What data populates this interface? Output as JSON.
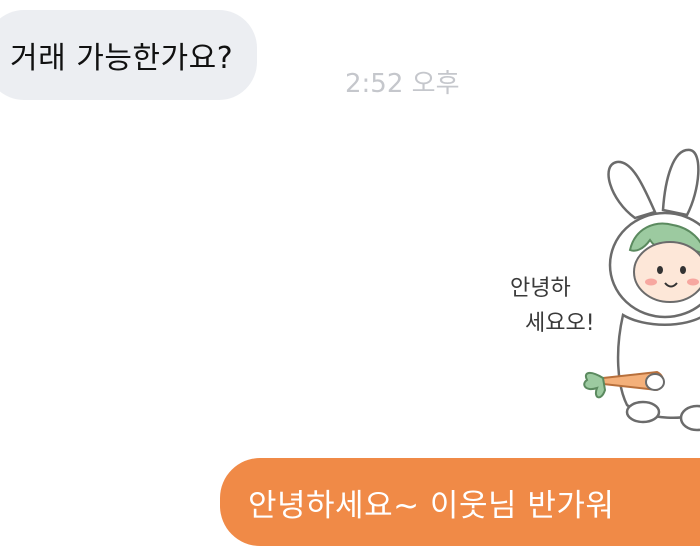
{
  "messages": {
    "incoming": {
      "text": "거래 가능한가요?",
      "time": "2:52 오후"
    },
    "sticker": {
      "icon": "rabbit-sticker-icon",
      "caption_line1": "안녕하",
      "caption_line2": "세요오!"
    },
    "outgoing": {
      "text": "안녕하세요~ 이웃님 반가워"
    }
  },
  "colors": {
    "incoming_bubble": "#eceef2",
    "outgoing_bubble": "#f08a47",
    "timestamp": "#c5c7cc",
    "background": "#ffffff"
  }
}
